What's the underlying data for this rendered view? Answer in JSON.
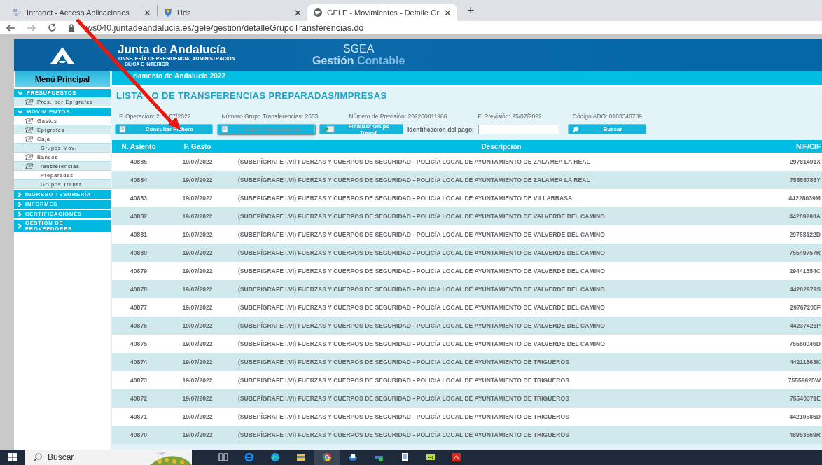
{
  "browser": {
    "tabs": [
      {
        "label": "Intranet - Acceso Aplicaciones",
        "close": "✕",
        "selected": false
      },
      {
        "label": "Uds",
        "close": "✕",
        "selected": false
      },
      {
        "label": "GELE - Movimientos - Detalle Gr",
        "close": "✕",
        "selected": true
      }
    ],
    "new_tab": "+",
    "address": "ws040.juntadeandalucia.es/gele/gestion/detalleGrupoTransferencias.do"
  },
  "header": {
    "brand": "Junta de Andalucía",
    "subtitle_lines": [
      "ONSEJERÍA DE PRESIDENCIA, ADMINISTRACIÓN",
      "BLICA E INTERIOR"
    ],
    "app_title": "SGEA",
    "app_subtitle_bold": "Gestión",
    "app_subtitle_light": "Contable"
  },
  "sidebar": {
    "title": "Menú Principal",
    "sections": [
      {
        "label": "PRESUPUESTOS",
        "expanded": true,
        "items": [
          {
            "label": "Pres. por Epígrafes",
            "kind": "icon"
          }
        ]
      },
      {
        "label": "MOVIMIENTOS",
        "expanded": true,
        "items": [
          {
            "label": "Gastos",
            "kind": "icon"
          },
          {
            "label": "Epígrafes",
            "kind": "icon"
          },
          {
            "label": "Caja",
            "kind": "icon",
            "children": [
              {
                "label": "Grupos Mov."
              }
            ]
          },
          {
            "label": "Bancos",
            "kind": "icon"
          },
          {
            "label": "Transferencias",
            "kind": "icon",
            "children": [
              {
                "label": "Preparadas"
              },
              {
                "label": "Grupos Transf."
              }
            ]
          }
        ]
      },
      {
        "label": "INGRESO TESORERÍA",
        "expanded": false
      },
      {
        "label": "INFORMES",
        "expanded": false
      },
      {
        "label": "CERTIFICACIONES",
        "expanded": false
      },
      {
        "label": "GESTIÓN DE PROVEEDORES",
        "expanded": false
      }
    ]
  },
  "breadcrumb": "rlamento de Andalucía 2022",
  "title_parts": [
    "LISTA",
    "O DE TRANSFERENCIAS PREPARADAS/IMPRESAS"
  ],
  "info": {
    "operacion_label": "F. Operación:",
    "operacion_value_parts": [
      "2",
      "07/2022"
    ],
    "fields": [
      "Número Grupo Transferencias: 2653",
      "Número de Previsión: 202200011986",
      "F. Previsión: 25/07/2022",
      "Código ADO: 0103346789"
    ]
  },
  "actions": [
    {
      "label": "Consultar Fichero",
      "disabled": false,
      "kind": "doc"
    },
    {
      "label": "Anexo Transferencia",
      "disabled": true,
      "kind": "doc"
    },
    {
      "label": "Finalizar Grupo Transf.",
      "disabled": false,
      "kind": "finish"
    }
  ],
  "payment_search": {
    "label": "Identificación del pago:",
    "button": "Buscar"
  },
  "table": {
    "columns": [
      "N. Asiento",
      "F. Gasto",
      "Descripción",
      "NIF/CIF"
    ],
    "rows": [
      [
        "40885",
        "19/07/2022",
        "(SUBEPÍGRAFE I.VI) FUERZAS Y CUERPOS DE SEGURIDAD - POLICÍA LOCAL DE AYUNTAMIENTO DE ZALAMEA LA REAL",
        "29781491X"
      ],
      [
        "40884",
        "19/07/2022",
        "(SUBEPÍGRAFE I.VI) FUERZAS Y CUERPOS DE SEGURIDAD - POLICÍA LOCAL DE AYUNTAMIENTO DE ZALAMEA LA REAL",
        "75555788Y"
      ],
      [
        "40883",
        "19/07/2022",
        "(SUBEPÍGRAFE I.VI) FUERZAS Y CUERPOS DE SEGURIDAD - POLICÍA LOCAL DE AYUNTAMIENTO DE VILLARRASA",
        "44228039M"
      ],
      [
        "40882",
        "19/07/2022",
        "(SUBEPÍGRAFE I.VI) FUERZAS Y CUERPOS DE SEGURIDAD - POLICÍA LOCAL DE AYUNTAMIENTO DE VALVERDE DEL CAMINO",
        "44209200A"
      ],
      [
        "40881",
        "19/07/2022",
        "(SUBEPÍGRAFE I.VI) FUERZAS Y CUERPOS DE SEGURIDAD - POLICÍA LOCAL DE AYUNTAMIENTO DE VALVERDE DEL CAMINO",
        "29758122D"
      ],
      [
        "40880",
        "19/07/2022",
        "(SUBEPÍGRAFE I.VI) FUERZAS Y CUERPOS DE SEGURIDAD - POLICÍA LOCAL DE AYUNTAMIENTO DE VALVERDE DEL CAMINO",
        "75549757R"
      ],
      [
        "40879",
        "19/07/2022",
        "(SUBEPÍGRAFE I.VI) FUERZAS Y CUERPOS DE SEGURIDAD - POLICÍA LOCAL DE AYUNTAMIENTO DE VALVERDE DEL CAMINO",
        "29441354C"
      ],
      [
        "40878",
        "19/07/2022",
        "(SUBEPÍGRAFE I.VI) FUERZAS Y CUERPOS DE SEGURIDAD - POLICÍA LOCAL DE AYUNTAMIENTO DE VALVERDE DEL CAMINO",
        "44202979S"
      ],
      [
        "40877",
        "19/07/2022",
        "(SUBEPÍGRAFE I.VI) FUERZAS Y CUERPOS DE SEGURIDAD - POLICÍA LOCAL DE AYUNTAMIENTO DE VALVERDE DEL CAMINO",
        "29767205F"
      ],
      [
        "40876",
        "19/07/2022",
        "(SUBEPÍGRAFE I.VI) FUERZAS Y CUERPOS DE SEGURIDAD - POLICÍA LOCAL DE AYUNTAMIENTO DE VALVERDE DEL CAMINO",
        "44237426P"
      ],
      [
        "40875",
        "19/07/2022",
        "(SUBEPÍGRAFE I.VI) FUERZAS Y CUERPOS DE SEGURIDAD - POLICÍA LOCAL DE AYUNTAMIENTO DE VALVERDE DEL CAMINO",
        "75560046D"
      ],
      [
        "40874",
        "19/07/2022",
        "(SUBEPÍGRAFE I.VI) FUERZAS Y CUERPOS DE SEGURIDAD - POLICÍA LOCAL DE AYUNTAMIENTO DE TRIGUEROS",
        "44211863K"
      ],
      [
        "40873",
        "19/07/2022",
        "(SUBEPÍGRAFE I.VI) FUERZAS Y CUERPOS DE SEGURIDAD - POLICÍA LOCAL DE AYUNTAMIENTO DE TRIGUEROS",
        "75559625W"
      ],
      [
        "40872",
        "19/07/2022",
        "(SUBEPÍGRAFE I.VI) FUERZAS Y CUERPOS DE SEGURIDAD - POLICÍA LOCAL DE AYUNTAMIENTO DE TRIGUEROS",
        "75540371E"
      ],
      [
        "40871",
        "19/07/2022",
        "(SUBEPÍGRAFE I.VI) FUERZAS Y CUERPOS DE SEGURIDAD - POLICÍA LOCAL DE AYUNTAMIENTO DE TRIGUEROS",
        "44210586D"
      ],
      [
        "40870",
        "19/07/2022",
        "(SUBEPÍGRAFE I.VI) FUERZAS Y CUERPOS DE SEGURIDAD - POLICÍA LOCAL DE AYUNTAMIENTO DE TRIGUEROS",
        "48953569R"
      ]
    ]
  },
  "taskbar": {
    "search_placeholder": "Buscar"
  },
  "annotation": {
    "kind": "arrow"
  }
}
